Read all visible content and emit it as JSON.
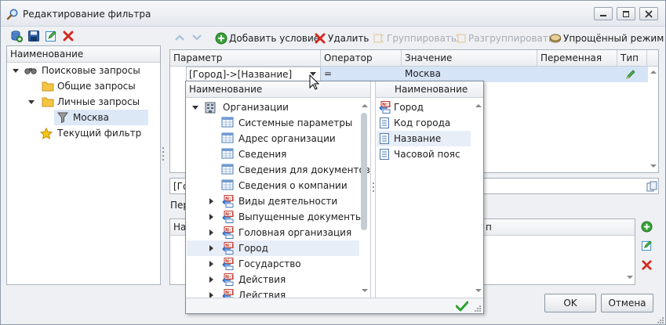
{
  "window": {
    "title": "Редактирование фильтра"
  },
  "left": {
    "header": "Наименование",
    "tree": [
      {
        "label": "Поисковые запросы"
      },
      {
        "label": "Общие запросы"
      },
      {
        "label": "Личные запросы"
      },
      {
        "label": "Москва"
      },
      {
        "label": "Текущий фильтр"
      }
    ]
  },
  "toolbar": {
    "add": "Добавить условие",
    "delete": "Удалить",
    "group": "Группировать",
    "ungroup": "Разгруппировать",
    "simple": "Упрощённый режим"
  },
  "grid": {
    "headers": [
      "Параметр",
      "Оператор",
      "Значение",
      "Переменная",
      "Тип"
    ],
    "row": {
      "param": "[Город]->[Название]",
      "op": "=",
      "value": "Москва"
    }
  },
  "lower": {
    "expr_prefix": "[Го",
    "label_prefix": "Пер",
    "col_left": "На",
    "col_right": "п"
  },
  "dropdown": {
    "left_header": "Наименование",
    "root": "Организации",
    "items": [
      {
        "label": "Системные параметры",
        "kind": "table"
      },
      {
        "label": "Адрес организации",
        "kind": "table"
      },
      {
        "label": "Сведения",
        "kind": "table"
      },
      {
        "label": "Сведения для документов",
        "kind": "table"
      },
      {
        "label": "Сведения о компании",
        "kind": "table"
      },
      {
        "label": "Виды деятельности",
        "kind": "n1"
      },
      {
        "label": "Выпущенные документы",
        "kind": "n1"
      },
      {
        "label": "Головная организация",
        "kind": "n1"
      },
      {
        "label": "Город",
        "kind": "n1"
      },
      {
        "label": "Государство",
        "kind": "n1"
      },
      {
        "label": "Действия",
        "kind": "n1"
      },
      {
        "label": "Действия",
        "kind": "n1"
      }
    ],
    "right_header": "Наименование",
    "fields": [
      {
        "label": "Город",
        "kind": "n1"
      },
      {
        "label": "Код города",
        "kind": "field"
      },
      {
        "label": "Название",
        "kind": "field"
      },
      {
        "label": "Часовой пояс",
        "kind": "field"
      }
    ]
  },
  "buttons": {
    "ok": "OK",
    "cancel": "Отмена"
  }
}
